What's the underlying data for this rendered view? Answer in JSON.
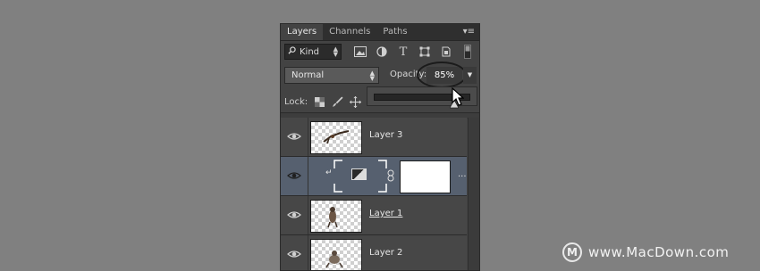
{
  "panel": {
    "tabs": [
      {
        "label": "Layers",
        "active": true
      },
      {
        "label": "Channels",
        "active": false
      },
      {
        "label": "Paths",
        "active": false
      }
    ],
    "menu_icon": "panel-menu-icon"
  },
  "filter": {
    "kind_label": "Kind",
    "icons": [
      "pixel-layer-icon",
      "adjustment-layer-icon",
      "type-layer-icon",
      "shape-layer-icon",
      "smart-object-icon",
      "filter-toggle-icon"
    ]
  },
  "blend": {
    "mode": "Normal",
    "opacity_label": "Opacity:",
    "opacity_value": "85%",
    "opacity_slider_level": 0.85
  },
  "lock": {
    "label": "Lock:",
    "icons": [
      "lock-transparent-icon",
      "lock-image-icon",
      "lock-position-icon"
    ]
  },
  "layers": [
    {
      "name": "Layer 3",
      "selected": false,
      "visible": true
    },
    {
      "name": "",
      "selected": true,
      "visible": true,
      "type": "adjustment",
      "clipped": true,
      "mask": "white"
    },
    {
      "name": "Layer 1",
      "selected": false,
      "visible": true,
      "underlined": true
    },
    {
      "name": "Layer 2",
      "selected": false,
      "visible": true
    }
  ],
  "watermark": {
    "logo_letter": "M",
    "text": "www.MacDown.com"
  },
  "colors": {
    "canvas_bg": "#808080",
    "panel_bg": "#434343",
    "selected_layer": "#56606f"
  }
}
